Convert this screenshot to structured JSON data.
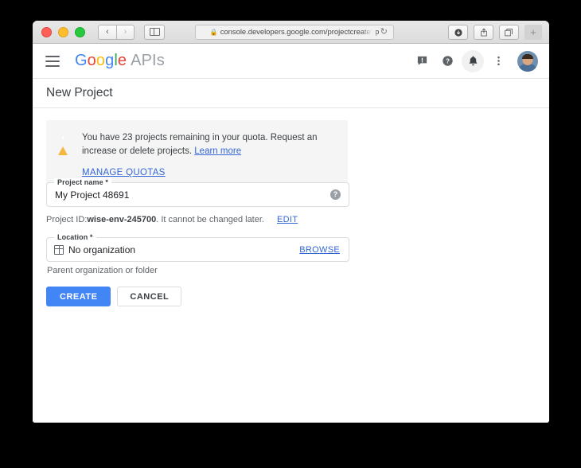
{
  "browser": {
    "traffic_lights": [
      "close",
      "minimize",
      "zoom"
    ],
    "back_label": "‹",
    "forward_label": "›",
    "sidebar_toggle_name": "sidebar-toggle",
    "url": "console.developers.google.com/projectcreate?p",
    "lock_icon": "lock-icon",
    "reload_label": "↻",
    "tools": [
      {
        "name": "downloads-icon",
        "glyph": "⬇"
      },
      {
        "name": "share-icon",
        "glyph": "⤴"
      },
      {
        "name": "tab-overview-icon",
        "glyph": "⧉"
      }
    ],
    "newtab_label": "+"
  },
  "header": {
    "menu_icon": "hamburger-icon",
    "brand": {
      "g": "G",
      "o1": "o",
      "o2": "o",
      "gl": "g",
      "l": "l",
      "e": "e",
      "suffix": "APIs"
    },
    "icons": [
      {
        "name": "feedback-icon",
        "glyph": "!"
      },
      {
        "name": "help-icon",
        "glyph": "?"
      },
      {
        "name": "notifications-icon",
        "glyph": "🔔"
      },
      {
        "name": "more-options-icon",
        "glyph": "⋮"
      }
    ],
    "avatar_name": "user-avatar"
  },
  "page": {
    "title": "New Project"
  },
  "quota_notice": {
    "icon": "warning-icon",
    "message_part1": "You have 23 projects remaining in your quota. Request an increase or delete projects.",
    "learn_more": "Learn more",
    "manage_quotas": "MANAGE QUOTAS"
  },
  "form": {
    "project_name": {
      "label": "Project name *",
      "value": "My Project 48691",
      "help_glyph": "?"
    },
    "project_id": {
      "prefix": "Project ID: ",
      "id": "wise-env-245700",
      "suffix": ". It cannot be changed later.",
      "edit_label": "EDIT"
    },
    "location": {
      "label": "Location *",
      "value": "No organization",
      "browse_label": "BROWSE",
      "helper": "Parent organization or folder"
    }
  },
  "actions": {
    "create_label": "CREATE",
    "cancel_label": "CANCEL"
  },
  "colors": {
    "primary_blue": "#4285f4",
    "link_blue": "#3367d6",
    "warning_amber": "#f4b740",
    "notice_bg": "#f5f5f5",
    "border_gray": "#dadce0"
  }
}
